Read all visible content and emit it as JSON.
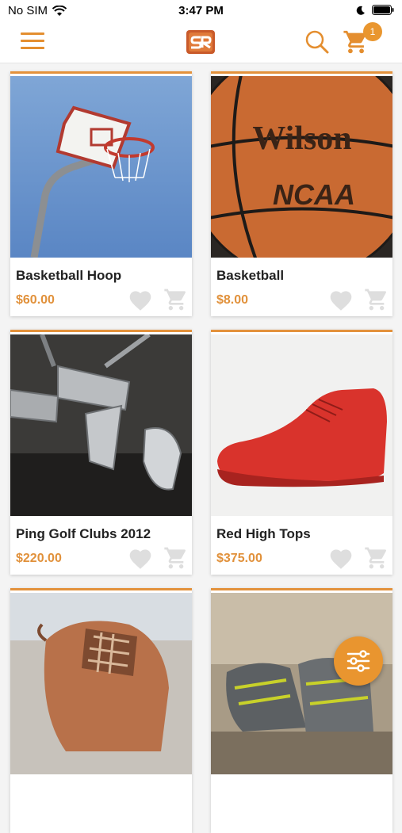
{
  "status_bar": {
    "carrier": "No SIM",
    "time": "3:47 PM"
  },
  "header": {
    "cart_count": "1",
    "accent": "#e48e2f"
  },
  "products": [
    {
      "name": "Basketball Hoop",
      "price": "$60.00"
    },
    {
      "name": "Basketball",
      "price": "$8.00"
    },
    {
      "name": "Ping Golf Clubs 2012",
      "price": "$220.00"
    },
    {
      "name": "Red High Tops",
      "price": "$375.00"
    },
    {
      "name": "",
      "price": ""
    },
    {
      "name": "",
      "price": ""
    }
  ]
}
